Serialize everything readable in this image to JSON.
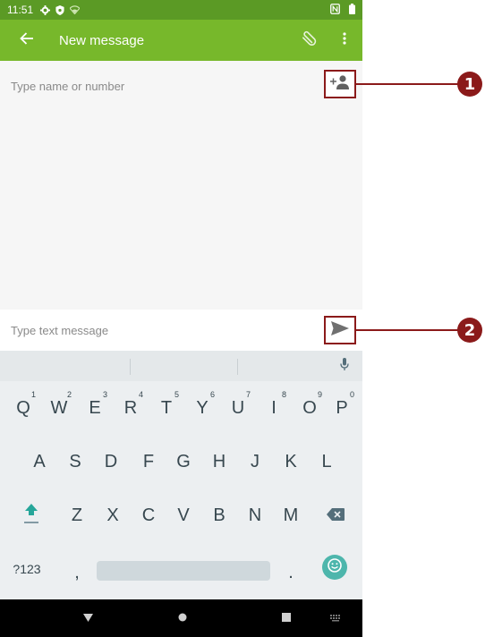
{
  "status_bar": {
    "time": "11:51",
    "icons": [
      "gear-icon",
      "shield-icon",
      "wifi-icon",
      "nfc-icon",
      "battery-icon"
    ]
  },
  "app_bar": {
    "title": "New message",
    "back_icon": "arrow-left-icon",
    "actions": [
      "paperclip-icon",
      "more-vert-icon"
    ]
  },
  "recipient": {
    "placeholder": "Type name or number",
    "add_contact_icon": "add-contact-icon"
  },
  "message": {
    "placeholder": "Type text message",
    "send_icon": "send-icon"
  },
  "keyboard": {
    "row1": [
      {
        "key": "Q",
        "num": "1"
      },
      {
        "key": "W",
        "num": "2"
      },
      {
        "key": "E",
        "num": "3"
      },
      {
        "key": "R",
        "num": "4"
      },
      {
        "key": "T",
        "num": "5"
      },
      {
        "key": "Y",
        "num": "6"
      },
      {
        "key": "U",
        "num": "7"
      },
      {
        "key": "I",
        "num": "8"
      },
      {
        "key": "O",
        "num": "9"
      },
      {
        "key": "P",
        "num": "0"
      }
    ],
    "row2": [
      "A",
      "S",
      "D",
      "F",
      "G",
      "H",
      "J",
      "K",
      "L"
    ],
    "row3": [
      "Z",
      "X",
      "C",
      "V",
      "B",
      "N",
      "M"
    ],
    "symbols_label": "?123",
    "comma_label": ",",
    "period_label": "."
  },
  "callouts": [
    "1",
    "2"
  ],
  "colors": {
    "status_bar": "#5b9a25",
    "app_bar": "#77b82b",
    "callout": "#8b1a1a",
    "keyboard_bg": "#eceff1",
    "accent_teal": "#4db6ac"
  }
}
